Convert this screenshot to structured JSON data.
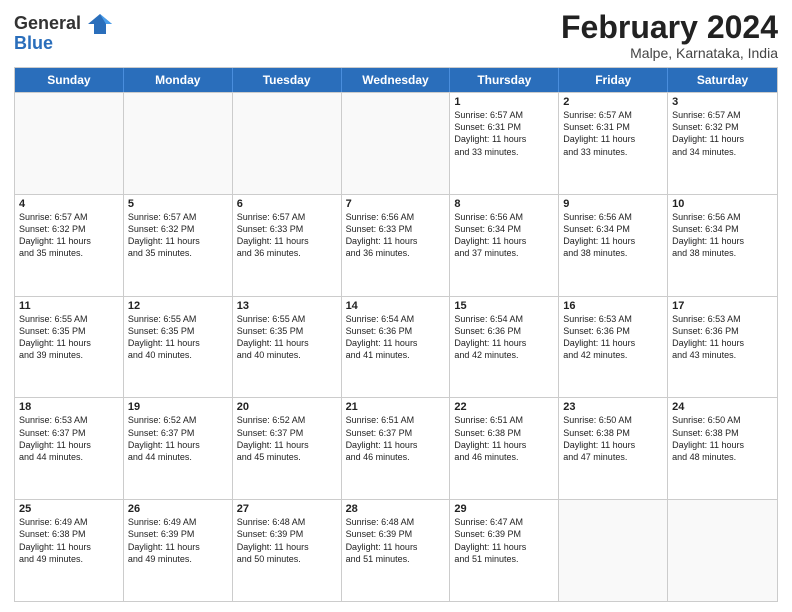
{
  "header": {
    "logo_general": "General",
    "logo_blue": "Blue",
    "title": "February 2024",
    "location": "Malpe, Karnataka, India"
  },
  "weekdays": [
    "Sunday",
    "Monday",
    "Tuesday",
    "Wednesday",
    "Thursday",
    "Friday",
    "Saturday"
  ],
  "rows": [
    [
      {
        "day": "",
        "info": "",
        "empty": true
      },
      {
        "day": "",
        "info": "",
        "empty": true
      },
      {
        "day": "",
        "info": "",
        "empty": true
      },
      {
        "day": "",
        "info": "",
        "empty": true
      },
      {
        "day": "1",
        "info": "Sunrise: 6:57 AM\nSunset: 6:31 PM\nDaylight: 11 hours\nand 33 minutes."
      },
      {
        "day": "2",
        "info": "Sunrise: 6:57 AM\nSunset: 6:31 PM\nDaylight: 11 hours\nand 33 minutes."
      },
      {
        "day": "3",
        "info": "Sunrise: 6:57 AM\nSunset: 6:32 PM\nDaylight: 11 hours\nand 34 minutes."
      }
    ],
    [
      {
        "day": "4",
        "info": "Sunrise: 6:57 AM\nSunset: 6:32 PM\nDaylight: 11 hours\nand 35 minutes."
      },
      {
        "day": "5",
        "info": "Sunrise: 6:57 AM\nSunset: 6:32 PM\nDaylight: 11 hours\nand 35 minutes."
      },
      {
        "day": "6",
        "info": "Sunrise: 6:57 AM\nSunset: 6:33 PM\nDaylight: 11 hours\nand 36 minutes."
      },
      {
        "day": "7",
        "info": "Sunrise: 6:56 AM\nSunset: 6:33 PM\nDaylight: 11 hours\nand 36 minutes."
      },
      {
        "day": "8",
        "info": "Sunrise: 6:56 AM\nSunset: 6:34 PM\nDaylight: 11 hours\nand 37 minutes."
      },
      {
        "day": "9",
        "info": "Sunrise: 6:56 AM\nSunset: 6:34 PM\nDaylight: 11 hours\nand 38 minutes."
      },
      {
        "day": "10",
        "info": "Sunrise: 6:56 AM\nSunset: 6:34 PM\nDaylight: 11 hours\nand 38 minutes."
      }
    ],
    [
      {
        "day": "11",
        "info": "Sunrise: 6:55 AM\nSunset: 6:35 PM\nDaylight: 11 hours\nand 39 minutes."
      },
      {
        "day": "12",
        "info": "Sunrise: 6:55 AM\nSunset: 6:35 PM\nDaylight: 11 hours\nand 40 minutes."
      },
      {
        "day": "13",
        "info": "Sunrise: 6:55 AM\nSunset: 6:35 PM\nDaylight: 11 hours\nand 40 minutes."
      },
      {
        "day": "14",
        "info": "Sunrise: 6:54 AM\nSunset: 6:36 PM\nDaylight: 11 hours\nand 41 minutes."
      },
      {
        "day": "15",
        "info": "Sunrise: 6:54 AM\nSunset: 6:36 PM\nDaylight: 11 hours\nand 42 minutes."
      },
      {
        "day": "16",
        "info": "Sunrise: 6:53 AM\nSunset: 6:36 PM\nDaylight: 11 hours\nand 42 minutes."
      },
      {
        "day": "17",
        "info": "Sunrise: 6:53 AM\nSunset: 6:36 PM\nDaylight: 11 hours\nand 43 minutes."
      }
    ],
    [
      {
        "day": "18",
        "info": "Sunrise: 6:53 AM\nSunset: 6:37 PM\nDaylight: 11 hours\nand 44 minutes."
      },
      {
        "day": "19",
        "info": "Sunrise: 6:52 AM\nSunset: 6:37 PM\nDaylight: 11 hours\nand 44 minutes."
      },
      {
        "day": "20",
        "info": "Sunrise: 6:52 AM\nSunset: 6:37 PM\nDaylight: 11 hours\nand 45 minutes."
      },
      {
        "day": "21",
        "info": "Sunrise: 6:51 AM\nSunset: 6:37 PM\nDaylight: 11 hours\nand 46 minutes."
      },
      {
        "day": "22",
        "info": "Sunrise: 6:51 AM\nSunset: 6:38 PM\nDaylight: 11 hours\nand 46 minutes."
      },
      {
        "day": "23",
        "info": "Sunrise: 6:50 AM\nSunset: 6:38 PM\nDaylight: 11 hours\nand 47 minutes."
      },
      {
        "day": "24",
        "info": "Sunrise: 6:50 AM\nSunset: 6:38 PM\nDaylight: 11 hours\nand 48 minutes."
      }
    ],
    [
      {
        "day": "25",
        "info": "Sunrise: 6:49 AM\nSunset: 6:38 PM\nDaylight: 11 hours\nand 49 minutes."
      },
      {
        "day": "26",
        "info": "Sunrise: 6:49 AM\nSunset: 6:39 PM\nDaylight: 11 hours\nand 49 minutes."
      },
      {
        "day": "27",
        "info": "Sunrise: 6:48 AM\nSunset: 6:39 PM\nDaylight: 11 hours\nand 50 minutes."
      },
      {
        "day": "28",
        "info": "Sunrise: 6:48 AM\nSunset: 6:39 PM\nDaylight: 11 hours\nand 51 minutes."
      },
      {
        "day": "29",
        "info": "Sunrise: 6:47 AM\nSunset: 6:39 PM\nDaylight: 11 hours\nand 51 minutes."
      },
      {
        "day": "",
        "info": "",
        "empty": true
      },
      {
        "day": "",
        "info": "",
        "empty": true
      }
    ]
  ]
}
